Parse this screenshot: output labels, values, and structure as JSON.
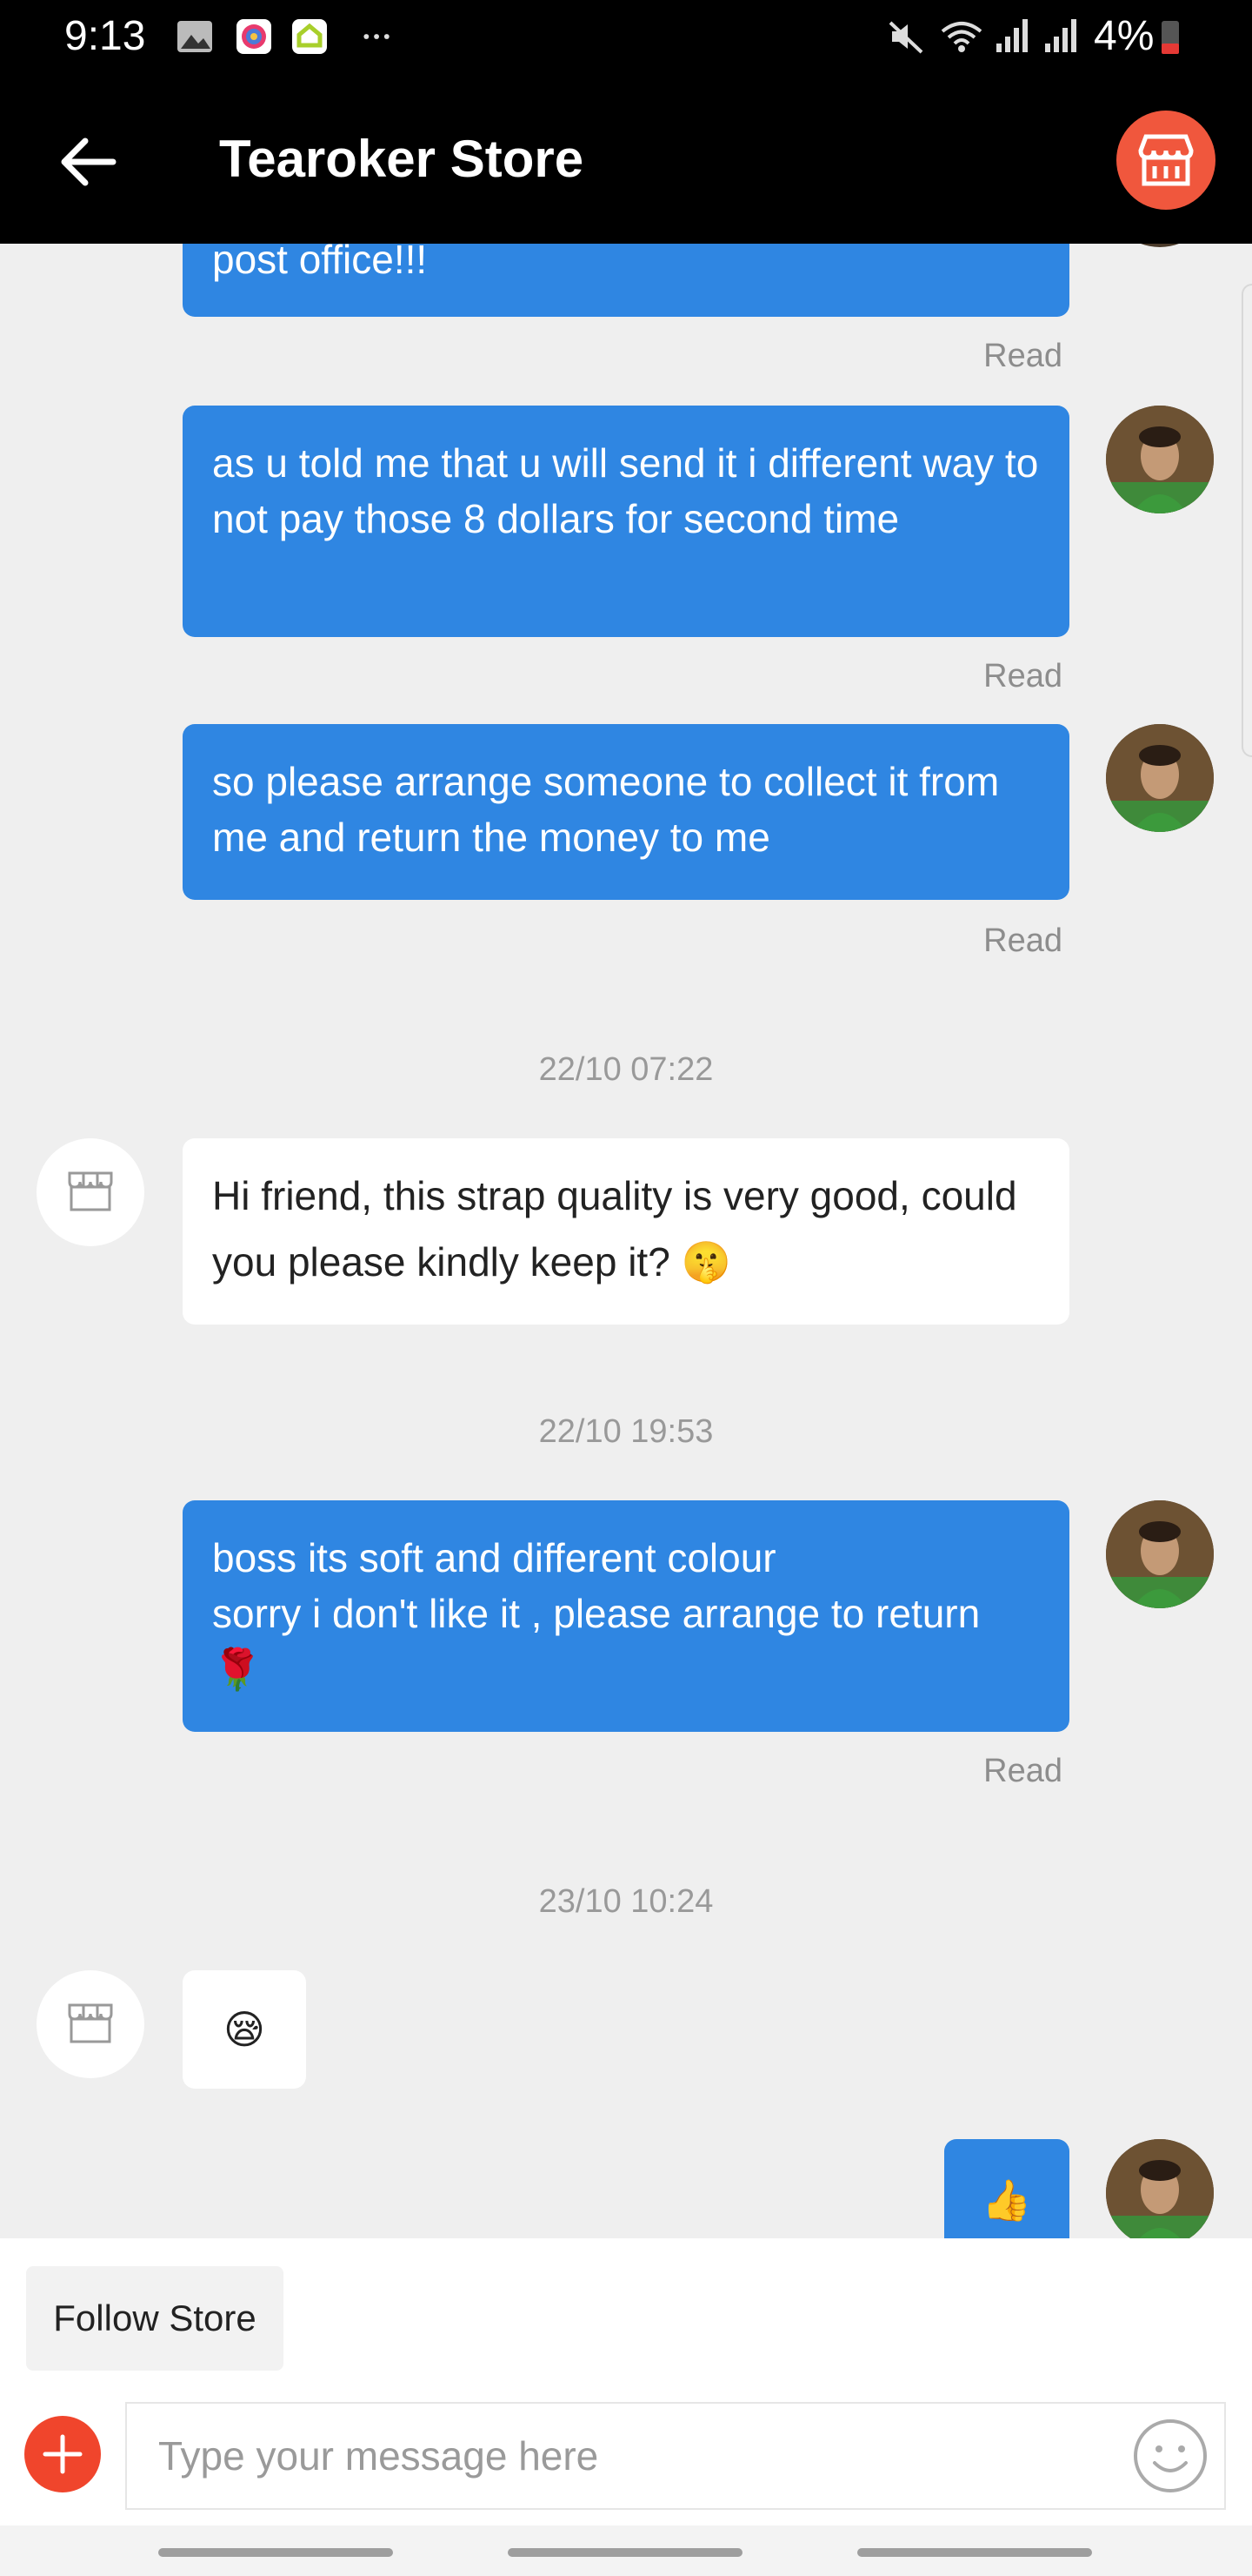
{
  "status_bar": {
    "time": "9:13",
    "battery": "4%"
  },
  "header": {
    "title": "Tearoker Store"
  },
  "messages": [
    {
      "text": "post office!!!",
      "status": "Read"
    },
    {
      "text": "as u told me that u will send it i different way to not pay those 8 dollars for second time",
      "status": "Read"
    },
    {
      "text": "so please arrange someone to collect it from me and return the money to me",
      "status": "Read"
    },
    {
      "timestamp": "22/10 07:22"
    },
    {
      "text": "Hi friend, this strap quality is very good, could you please kindly keep it? 🤫"
    },
    {
      "timestamp": "22/10 19:53"
    },
    {
      "line1": "boss its soft and different colour",
      "line2": "sorry i don't like it , please arrange to return",
      "line3": "🌹",
      "status": "Read"
    },
    {
      "timestamp": "23/10 10:24"
    },
    {
      "text": "😪"
    },
    {
      "text": "👍"
    }
  ],
  "footer": {
    "follow_label": "Follow Store",
    "input_placeholder": "Type your message here"
  },
  "colors": {
    "my_bubble": "#2f86e2",
    "store_accent": "#f0573d",
    "header_bg": "#000000"
  }
}
